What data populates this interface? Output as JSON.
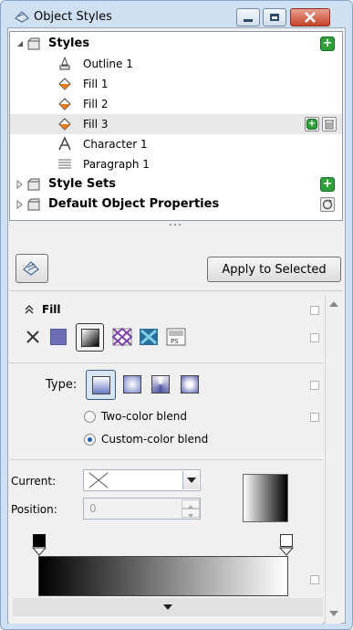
{
  "window": {
    "title": "Object Styles",
    "controls": [
      "minimize",
      "maximize",
      "close"
    ]
  },
  "tree": {
    "styles": {
      "label": "Styles",
      "children": [
        {
          "label": "Outline 1",
          "icon": "outline-pen-icon"
        },
        {
          "label": "Fill 1",
          "icon": "fill-bucket-icon"
        },
        {
          "label": "Fill 2",
          "icon": "fill-bucket-icon"
        },
        {
          "label": "Fill 3",
          "icon": "fill-bucket-icon",
          "selected": true
        },
        {
          "label": "Character 1",
          "icon": "character-icon"
        },
        {
          "label": "Paragraph 1",
          "icon": "paragraph-icon"
        }
      ]
    },
    "style_sets": {
      "label": "Style Sets"
    },
    "default_props": {
      "label": "Default Object Properties"
    }
  },
  "apply_button": {
    "label": "Apply to Selected"
  },
  "fill": {
    "title": "Fill",
    "types_label": "Type:",
    "two_color": "Two-color blend",
    "custom_color": "Custom-color blend",
    "selected_blend": "custom",
    "current_label": "Current:",
    "position_label": "Position:",
    "position_value": "0"
  },
  "colors": {
    "accent_green": "#2f9e3b",
    "close_red": "#c5422b",
    "selection": "#e8e8e8"
  }
}
